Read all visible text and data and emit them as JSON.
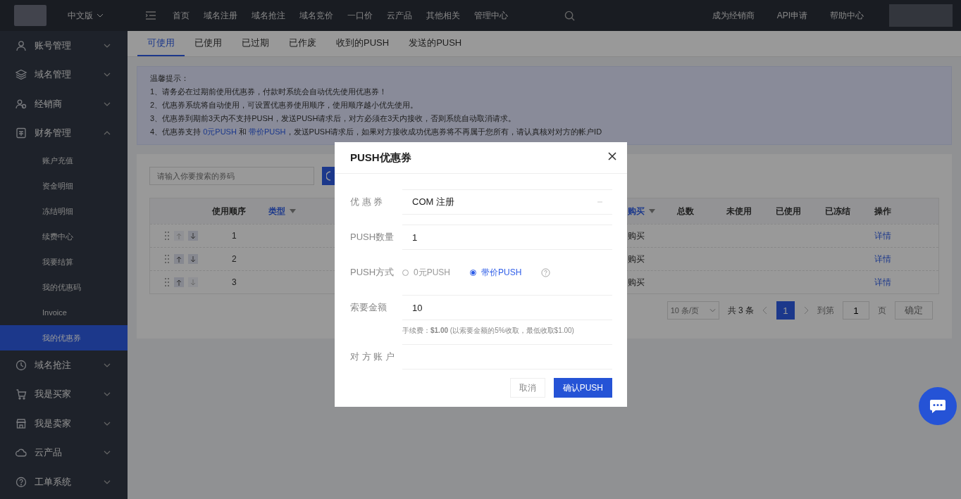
{
  "topbar": {
    "language": "中文版",
    "language_menu_expanded": false,
    "nav": [
      "首页",
      "域名注册",
      "域名抢注",
      "域名竞价",
      "一口价",
      "云产品",
      "其他相关",
      "管理中心"
    ],
    "right_links": [
      "成为经销商",
      "API申请",
      "帮助中心"
    ]
  },
  "sidebar": {
    "items": [
      {
        "label": "账号管理",
        "expanded": false
      },
      {
        "label": "域名管理",
        "expanded": false
      },
      {
        "label": "经销商",
        "expanded": false
      },
      {
        "label": "财务管理",
        "expanded": true,
        "children": [
          {
            "label": "账户充值",
            "selected": false
          },
          {
            "label": "资金明细",
            "selected": false
          },
          {
            "label": "冻结明细",
            "selected": false
          },
          {
            "label": "续费中心",
            "selected": false
          },
          {
            "label": "我要结算",
            "selected": false
          },
          {
            "label": "我的优惠码",
            "selected": false
          },
          {
            "label": "Invoice",
            "selected": false
          },
          {
            "label": "我的优惠券",
            "selected": true
          }
        ]
      },
      {
        "label": "域名抢注",
        "expanded": false
      },
      {
        "label": "我是买家",
        "expanded": false
      },
      {
        "label": "我是卖家",
        "expanded": false
      },
      {
        "label": "云产品",
        "expanded": false
      },
      {
        "label": "工单系统",
        "expanded": false
      }
    ]
  },
  "tabs": [
    {
      "label": "可使用",
      "selected": true
    },
    {
      "label": "已使用",
      "selected": false
    },
    {
      "label": "已过期",
      "selected": false
    },
    {
      "label": "已作废",
      "selected": false
    },
    {
      "label": "收到的PUSH",
      "selected": false
    },
    {
      "label": "发送的PUSH",
      "selected": false
    }
  ],
  "notice": {
    "title": "温馨提示：",
    "lines": [
      "1、请务必在过期前使用优惠券，付款时系统会自动优先使用优惠券！",
      "2、优惠券系统将自动使用，可设置优惠券使用顺序，使用顺序越小优先使用。",
      "3、优惠券到期前3天内不支持PUSH，发送PUSH请求后，对方必须在3天内接收，否则系统自动取消请求。"
    ],
    "line_4": {
      "prefix": "4、优惠券支持 ",
      "link_1": "0元PUSH",
      "middle": " 和 ",
      "link_2": "带价PUSH",
      "suffix": "，发送PUSH请求后，如果对方接收成功优惠券将不再属于您所有，请认真核对对方的帐户ID"
    }
  },
  "search": {
    "placeholder": "请输入你要搜索的券码"
  },
  "table": {
    "columns": [
      {
        "label": "使用顺序",
        "filter": false
      },
      {
        "label": "类型",
        "filter": true
      },
      {
        "label": "购买",
        "filter": true
      },
      {
        "label": "总数",
        "filter": false
      },
      {
        "label": "未使用",
        "filter": false
      },
      {
        "label": "已使用",
        "filter": false
      },
      {
        "label": "已冻结",
        "filter": false
      },
      {
        "label": "操作",
        "filter": false
      }
    ],
    "rows": [
      {
        "order": "1",
        "up_enabled": false,
        "down_enabled": true,
        "column_3": "购买",
        "action": "详情"
      },
      {
        "order": "2",
        "up_enabled": true,
        "down_enabled": true,
        "column_3": "购买",
        "action": "详情"
      },
      {
        "order": "3",
        "up_enabled": true,
        "down_enabled": false,
        "column_3": "购买",
        "action": "详情"
      }
    ]
  },
  "pagination": {
    "page_size": "10 条/页",
    "total": "共 3 条",
    "pages": [
      {
        "label": "1",
        "selected": true
      }
    ],
    "goto_label": "到第",
    "goto_value": "1",
    "page_unit": "页",
    "confirm": "确定"
  },
  "modal": {
    "title": "PUSH优惠券",
    "fields": [
      {
        "kind": "select",
        "label": "优 惠 券",
        "value": "COM 注册"
      },
      {
        "kind": "input",
        "label": "PUSH数量",
        "value": "1"
      },
      {
        "kind": "radio",
        "label": "PUSH方式",
        "options": [
          {
            "label": "0元PUSH",
            "selected": false
          },
          {
            "label": "带价PUSH",
            "selected": true
          }
        ]
      },
      {
        "kind": "input",
        "label": "索要金额",
        "value": "10",
        "hint": "手续费：**$1.00** (以索要金额的5%收取，最低收取$1.00)"
      },
      {
        "kind": "input",
        "label": "对 方 账 户"
      }
    ],
    "buttons": [
      {
        "label": "取消",
        "kind": "secondary"
      },
      {
        "label": "确认PUSH",
        "kind": "primary"
      }
    ]
  }
}
